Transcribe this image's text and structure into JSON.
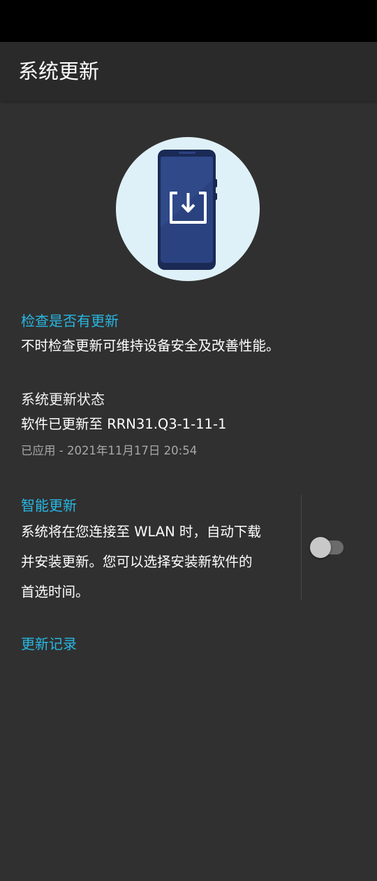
{
  "header": {
    "title": "系统更新"
  },
  "hero": {
    "icon": "phone-download-icon"
  },
  "check_update": {
    "title": "检查是否有更新",
    "description": "不时检查更新可维持设备安全及改善性能。"
  },
  "status": {
    "title": "系统更新状态",
    "version_text": "软件已更新至 RRN31.Q3-1-11-1",
    "applied_text": "已应用 - 2021年11月17日 20:54"
  },
  "smart_update": {
    "title": "智能更新",
    "description_lines": [
      "系统将在您连接至 WLAN 时，自动下载",
      "并安装更新。您可以选择安装新软件的",
      "首选时间。"
    ],
    "toggle_on": false
  },
  "history": {
    "label": "更新记录"
  },
  "colors": {
    "accent": "#28b7e3",
    "background": "#303030",
    "app_bar": "#2a2a2a"
  }
}
